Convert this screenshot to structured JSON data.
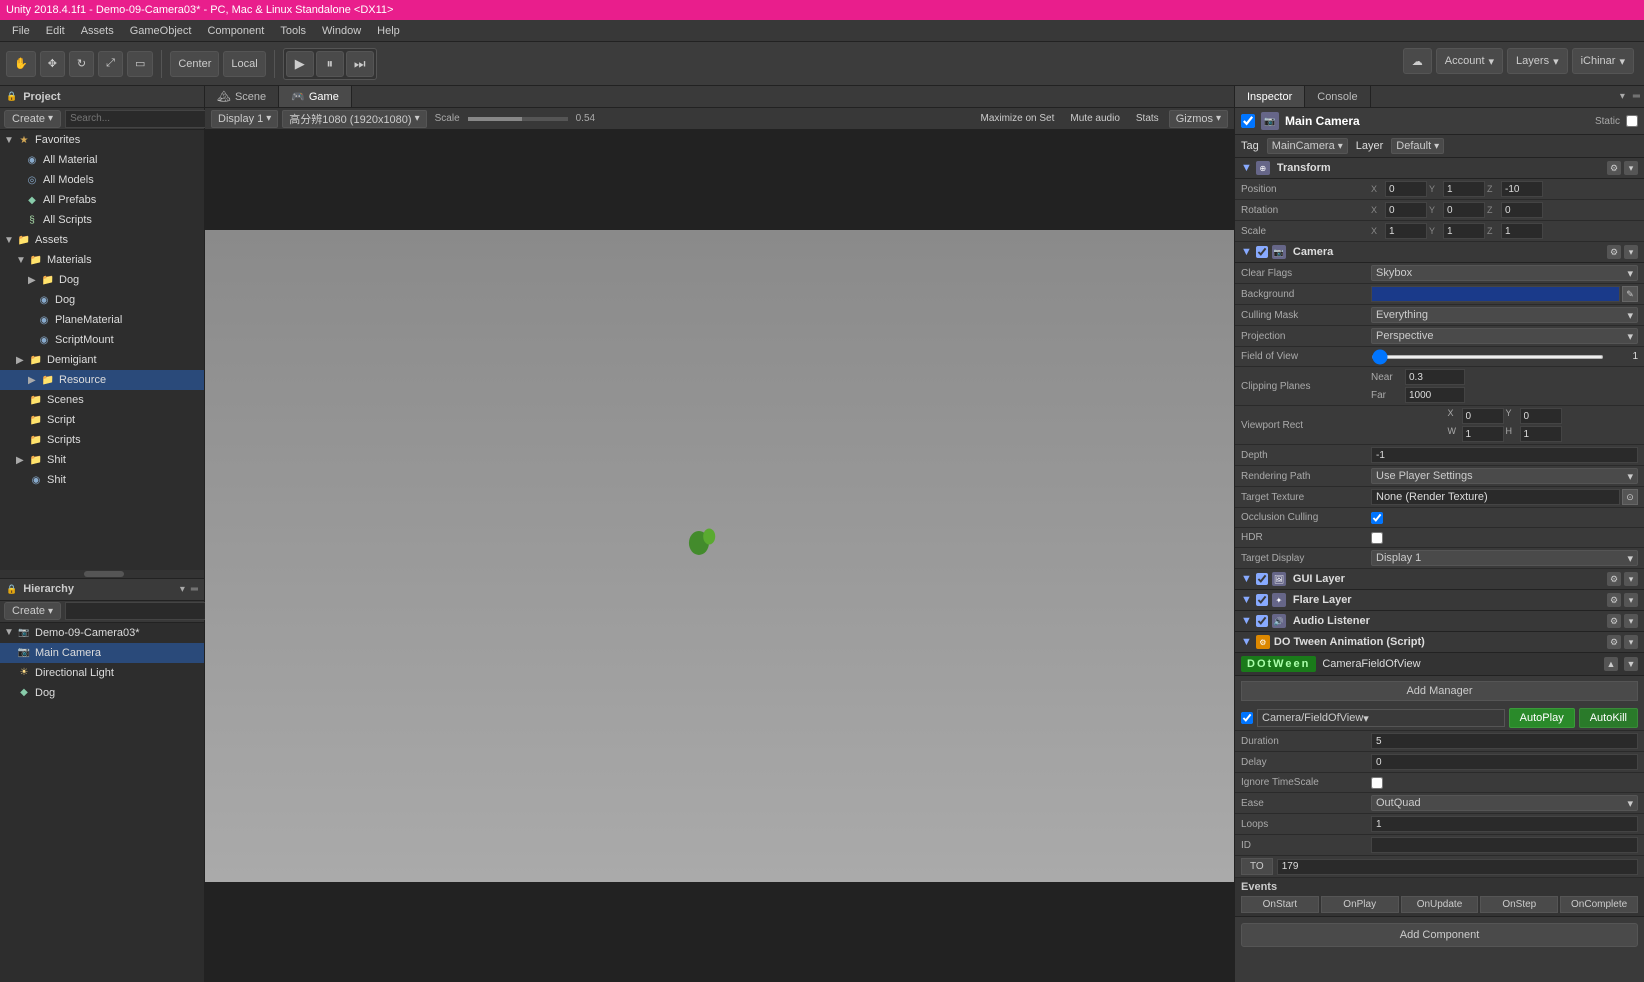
{
  "titlebar": {
    "text": "Unity 2018.4.1f1 - Demo-09-Camera03* - PC, Mac & Linux Standalone <DX11>"
  },
  "menubar": {
    "items": [
      "File",
      "Edit",
      "Assets",
      "GameObject",
      "Component",
      "Tools",
      "Window",
      "Help"
    ]
  },
  "toolbar": {
    "center_btn": "Center",
    "local_btn": "Local",
    "account_label": "Account",
    "layers_label": "Layers",
    "ichinari_label": "iChinar"
  },
  "tabs": {
    "scene": "Scene",
    "game": "Game"
  },
  "game_toolbar": {
    "display": "Display 1",
    "resolution": "高分辨1080 (1920x1080)",
    "scale_label": "Scale",
    "scale_value": "0.54",
    "maximize": "Maximize on Set",
    "mute": "Mute audio",
    "stats": "Stats",
    "gizmos": "Gizmos"
  },
  "project_panel": {
    "title": "Project",
    "create_label": "Create",
    "favorites": {
      "label": "Favorites",
      "items": [
        {
          "name": "All Material",
          "icon": "material"
        },
        {
          "name": "All Models",
          "icon": "model"
        },
        {
          "name": "All Prefabs",
          "icon": "prefab"
        },
        {
          "name": "All Scripts",
          "icon": "script"
        }
      ]
    },
    "assets": {
      "label": "Assets",
      "items": [
        {
          "name": "Materials",
          "icon": "folder",
          "indent": 1
        },
        {
          "name": "Dog",
          "icon": "folder",
          "indent": 2
        },
        {
          "name": "Dog",
          "icon": "material",
          "indent": 2
        },
        {
          "name": "PlaneMaterial",
          "icon": "material",
          "indent": 2
        },
        {
          "name": "ScriptMount",
          "icon": "material",
          "indent": 2
        }
      ]
    },
    "assets2": {
      "label": "Assets",
      "items": [
        {
          "name": "Demigiant",
          "icon": "folder",
          "indent": 1
        },
        {
          "name": "Resource",
          "icon": "folder",
          "indent": 2
        },
        {
          "name": "Scenes",
          "icon": "folder",
          "indent": 2
        },
        {
          "name": "Script",
          "icon": "folder",
          "indent": 2
        },
        {
          "name": "Scripts",
          "icon": "folder",
          "indent": 2
        }
      ]
    },
    "shit_items": [
      {
        "name": "Shit",
        "icon": "folder",
        "indent": 1
      },
      {
        "name": "Shit",
        "icon": "material",
        "indent": 2
      }
    ]
  },
  "hierarchy_panel": {
    "title": "Hierarchy",
    "create_label": "Create",
    "scene_name": "Demo-09-Camera03*",
    "items": [
      {
        "name": "Main Camera",
        "icon": "camera",
        "indent": 1,
        "selected": true
      },
      {
        "name": "Directional Light",
        "icon": "light",
        "indent": 1
      },
      {
        "name": "Dog",
        "icon": "prefab",
        "indent": 1
      }
    ]
  },
  "inspector": {
    "title": "Inspector",
    "console_tab": "Console",
    "object_name": "Main Camera",
    "static_label": "Static",
    "tag_label": "Tag",
    "tag_value": "MainCamera",
    "layer_label": "Layer",
    "layer_value": "Default",
    "transform": {
      "title": "Transform",
      "position": {
        "label": "Position",
        "x": "0",
        "y": "1",
        "z": "-10"
      },
      "rotation": {
        "label": "Rotation",
        "x": "0",
        "y": "0",
        "z": "0"
      },
      "scale": {
        "label": "Scale",
        "x": "1",
        "y": "1",
        "z": "1"
      }
    },
    "camera": {
      "title": "Camera",
      "clear_flags": {
        "label": "Clear Flags",
        "value": "Skybox"
      },
      "background": {
        "label": "Background"
      },
      "culling_mask": {
        "label": "Culling Mask",
        "value": "Everything"
      },
      "projection": {
        "label": "Projection",
        "value": "Perspective"
      },
      "field_of_view": {
        "label": "Field of View",
        "value": "1"
      },
      "clipping_planes": {
        "label": "Clipping Planes",
        "near_label": "Near",
        "near_value": "0.3",
        "far_label": "Far",
        "far_value": "1000"
      },
      "viewport_rect": {
        "label": "Viewport Rect",
        "x": "0",
        "y": "0",
        "w": "1",
        "h": "1"
      },
      "depth": {
        "label": "Depth",
        "value": "-1"
      },
      "rendering_path": {
        "label": "Rendering Path",
        "value": "Use Player Settings"
      },
      "target_texture": {
        "label": "Target Texture",
        "value": "None (Render Texture)"
      },
      "occlusion_culling": {
        "label": "Occlusion Culling"
      },
      "hdr": {
        "label": "HDR"
      },
      "target_display": {
        "label": "Target Display",
        "value": "Display 1"
      }
    },
    "gui_layer": {
      "title": "GUI Layer"
    },
    "flare_layer": {
      "title": "Flare Layer"
    },
    "audio_listener": {
      "title": "Audio Listener"
    },
    "dotween": {
      "title": "DO Tween Animation (Script)",
      "logo_text": "DOtWeen",
      "component_name": "CameraFieldOfView",
      "add_manager": "Add Manager",
      "target_dropdown": "Camera/FieldOfView",
      "autoplay": "AutoPlay",
      "autokill": "AutoKill",
      "duration_label": "Duration",
      "duration_value": "5",
      "delay_label": "Delay",
      "delay_value": "0",
      "ignore_timescale_label": "Ignore TimeScale",
      "ease_label": "Ease",
      "ease_value": "OutQuad",
      "loops_label": "Loops",
      "loops_value": "1",
      "id_label": "ID",
      "id_value": "",
      "to_label": "TO",
      "to_value": "179",
      "events": {
        "title": "Events",
        "on_start": "OnStart",
        "on_play": "OnPlay",
        "on_update": "OnUpdate",
        "on_step": "OnStep",
        "on_complete": "OnComplete"
      }
    },
    "add_component": "Add Component"
  }
}
